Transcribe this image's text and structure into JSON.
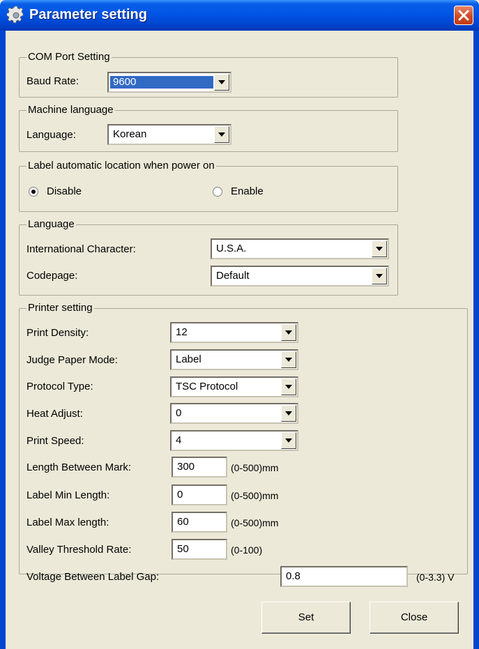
{
  "window": {
    "title": "Parameter setting"
  },
  "com_port": {
    "legend": "COM Port Setting",
    "baud_label": "Baud Rate:",
    "baud_value": "9600"
  },
  "machine_language": {
    "legend": "Machine language",
    "language_label": "Language:",
    "language_value": "Korean"
  },
  "label_auto_location": {
    "legend": "Label automatic location when power on",
    "disable_label": "Disable",
    "enable_label": "Enable",
    "selected": "Disable"
  },
  "language_group": {
    "legend": "Language",
    "intl_char_label": "International Character:",
    "intl_char_value": "U.S.A.",
    "codepage_label": "Codepage:",
    "codepage_value": "Default"
  },
  "printer_setting": {
    "legend": "Printer setting",
    "print_density_label": "Print Density:",
    "print_density_value": "12",
    "judge_paper_label": "Judge Paper Mode:",
    "judge_paper_value": "Label",
    "protocol_label": "Protocol Type:",
    "protocol_value": "TSC Protocol",
    "heat_adjust_label": "Heat Adjust:",
    "heat_adjust_value": "0",
    "print_speed_label": "Print Speed:",
    "print_speed_value": "4",
    "length_mark_label": "Length Between Mark:",
    "length_mark_value": "300",
    "length_mark_range": "(0-500)mm",
    "label_min_label": "Label Min Length:",
    "label_min_value": "0",
    "label_min_range": "(0-500)mm",
    "label_max_label": "Label Max length:",
    "label_max_value": "60",
    "label_max_range": "(0-500)mm",
    "valley_label": "Valley Threshold Rate:",
    "valley_value": "50",
    "valley_range": "(0-100)",
    "voltage_label": "Voltage Between Label Gap:",
    "voltage_value": "0.8",
    "voltage_range": "(0-3.3) V"
  },
  "buttons": {
    "set_label": "Set",
    "close_label": "Close"
  },
  "icons": {
    "title_icon": "gear-icon",
    "close_icon": "close-icon",
    "dropdown_icon": "dropdown-arrow-icon"
  },
  "colors": {
    "titlebar": "#0055e5",
    "close_button": "#d24a22",
    "selection": "#316ac5",
    "dialog_bg": "#ece9d8"
  }
}
